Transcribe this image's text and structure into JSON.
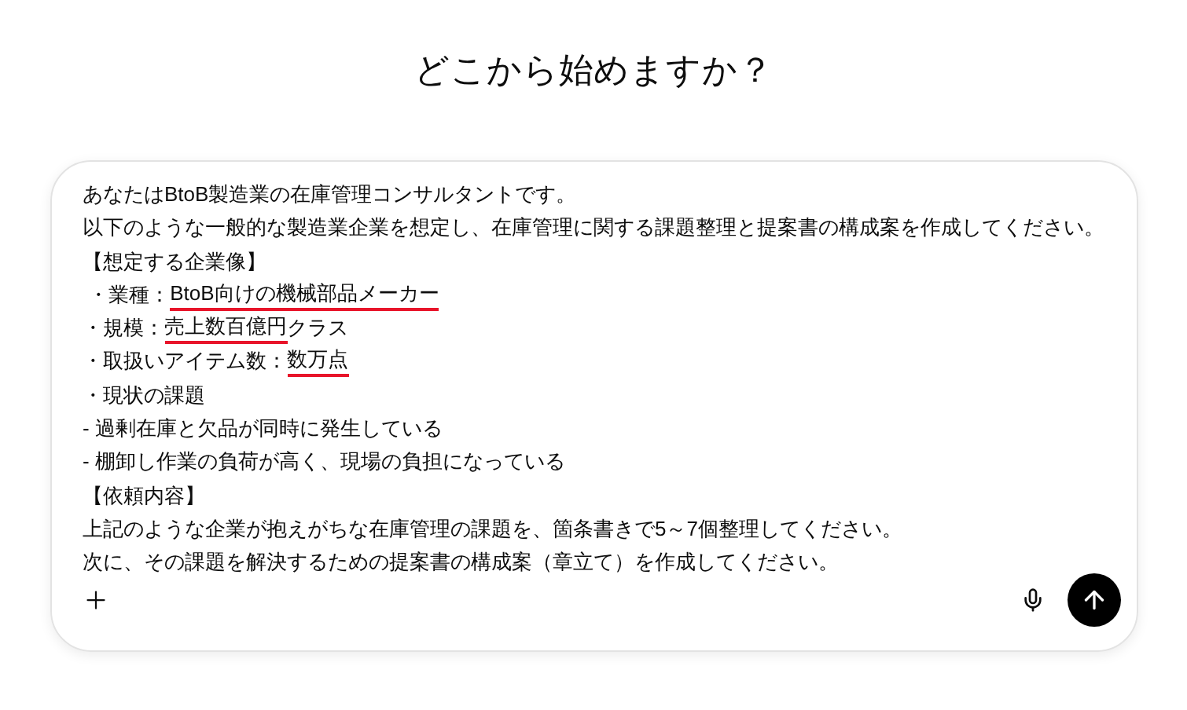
{
  "heading": "どこから始めますか？",
  "composer": {
    "lines": [
      [
        {
          "text": "あなたはBtoB製造業の在庫管理コンサルタントです。",
          "underlined": false
        }
      ],
      [
        {
          "text": "以下のような一般的な製造業企業を想定し、在庫管理に関する課題整理と提案書の構成案を作成してください。",
          "underlined": false
        }
      ],
      [
        {
          "text": "【想定する企業像】",
          "underlined": false
        }
      ],
      [
        {
          "text": " ・業種：",
          "underlined": false
        },
        {
          "text": "BtoB向けの機械部品メーカー",
          "underlined": true
        }
      ],
      [
        {
          "text": "・規模：",
          "underlined": false
        },
        {
          "text": "売上数百億円",
          "underlined": true
        },
        {
          "text": "クラス",
          "underlined": false
        }
      ],
      [
        {
          "text": "・取扱いアイテム数：",
          "underlined": false
        },
        {
          "text": "数万点",
          "underlined": true
        }
      ],
      [
        {
          "text": "・現状の課題",
          "underlined": false
        }
      ],
      [
        {
          "text": "- 過剰在庫と欠品が同時に発生している",
          "underlined": false
        }
      ],
      [
        {
          "text": "- 棚卸し作業の負荷が高く、現場の負担になっている",
          "underlined": false
        }
      ],
      [
        {
          "text": "【依頼内容】",
          "underlined": false
        }
      ],
      [
        {
          "text": "上記のような企業が抱えがちな在庫管理の課題を、箇条書きで5～7個整理してください。",
          "underlined": false
        }
      ],
      [
        {
          "text": "次に、その課題を解決するための提案書の構成案（章立て）を作成してください。",
          "underlined": false
        }
      ]
    ]
  }
}
